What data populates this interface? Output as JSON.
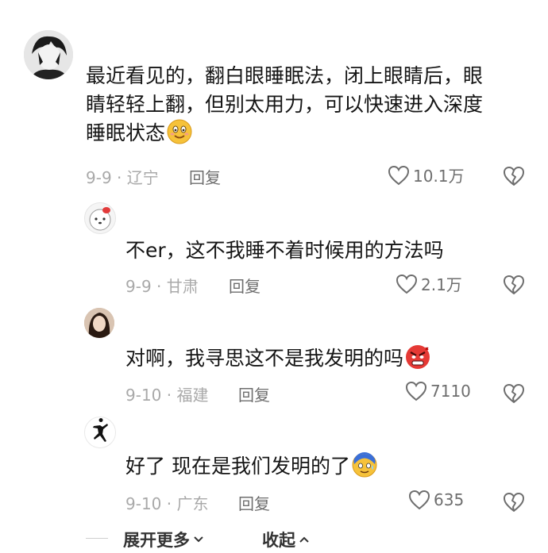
{
  "comments": [
    {
      "text_lines": [
        "最近看见的，翻白眼睡眠法，闭上眼睛后，眼",
        "睛轻轻上翻，但别太用力，可以快速进入深度",
        "睡眠状态"
      ],
      "emoji": "smile-emoji",
      "meta": "9-9 · 辽宁",
      "reply": "回复",
      "likes": "10.1万"
    },
    {
      "text": "不er，这不我睡不着时候用的方法吗",
      "meta": "9-9 · 甘肃",
      "reply": "回复",
      "likes": "2.1万"
    },
    {
      "text": "对啊，我寻思这不是我发明的吗",
      "emoji": "angry-emoji",
      "meta": "9-10 · 福建",
      "reply": "回复",
      "likes": "7110"
    },
    {
      "text": "好了 现在是我们发明的了",
      "emoji": "sweat-emoji",
      "meta": "9-10 · 广东",
      "reply": "回复",
      "likes": "635"
    }
  ],
  "footer": {
    "expand_more": "展开更多",
    "collapse": "收起"
  },
  "colors": {
    "meta": "#a9a9a9",
    "action": "#6e6e6e",
    "text": "#151515"
  }
}
